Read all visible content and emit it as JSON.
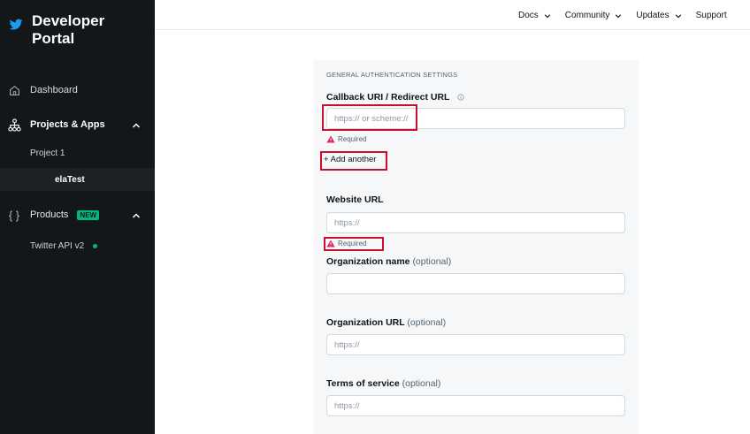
{
  "sidebar": {
    "brand": "Developer Portal",
    "items": {
      "dashboard": "Dashboard",
      "projects_apps": "Projects & Apps",
      "project1": "Project 1",
      "app": "elaTest",
      "products": "Products",
      "products_badge": "NEW",
      "twitter_api": "Twitter API v2"
    }
  },
  "topnav": {
    "docs": "Docs",
    "community": "Community",
    "updates": "Updates",
    "support": "Support"
  },
  "form": {
    "section_title": "GENERAL AUTHENTICATION SETTINGS",
    "callback": {
      "label": "Callback URI / Redirect URL",
      "placeholder": "https:// or scheme://",
      "error": "Required",
      "add_another": "+ Add another"
    },
    "website": {
      "label": "Website URL",
      "placeholder": "https://",
      "error": "Required"
    },
    "org_name": {
      "label": "Organization name",
      "optional": "(optional)",
      "placeholder": ""
    },
    "org_url": {
      "label": "Organization URL",
      "optional": "(optional)",
      "placeholder": "https://"
    },
    "tos": {
      "label": "Terms of service",
      "optional": "(optional)",
      "placeholder": "https://"
    }
  },
  "colors": {
    "sidebar_bg": "#14171a",
    "accent_green": "#00ba7c",
    "brand_blue": "#1d9bf0",
    "error_red": "#e0245e",
    "highlight_red": "#c8102e"
  }
}
